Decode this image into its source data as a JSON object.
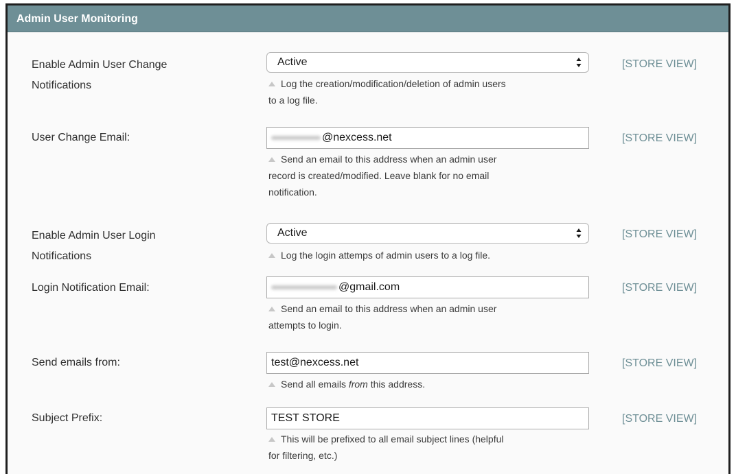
{
  "section": {
    "title": "Admin User Monitoring"
  },
  "store_view_label": "[STORE VIEW]",
  "rows": [
    {
      "label_line1": "Enable Admin User Change",
      "label_line2": "Notifications",
      "value": "Active",
      "note_lines": [
        "Log the creation/modification/deletion of admin users",
        "to a log file."
      ]
    },
    {
      "label_line1": "User Change Email:",
      "value": "@nexcess.net",
      "note_lines": [
        "Send an email to this address when an admin user",
        "record is created/modified. Leave blank for no email",
        "notification."
      ]
    },
    {
      "label_line1": "Enable Admin User Login",
      "label_line2": "Notifications",
      "value": "Active",
      "note_lines": [
        "Log the login attemps of admin users to a log file."
      ]
    },
    {
      "label_line1": "Login Notification Email:",
      "value": "@gmail.com",
      "note_lines": [
        "Send an email to this address when an admin user",
        "attempts to login."
      ]
    },
    {
      "label_line1": "Send emails from:",
      "value": "test@nexcess.net",
      "note_before": "Send all emails ",
      "note_em": "from",
      "note_after": " this address."
    },
    {
      "label_line1": "Subject Prefix:",
      "value": "TEST STORE",
      "note_lines": [
        "This will be prefixed to all email subject lines (helpful",
        "for filtering, etc.)"
      ]
    }
  ]
}
